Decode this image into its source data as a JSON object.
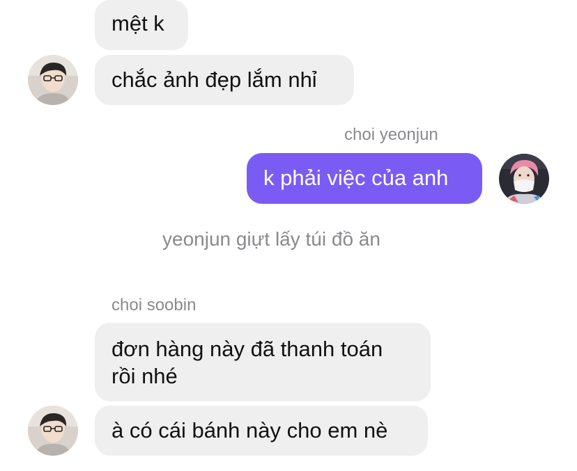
{
  "messages": {
    "m1": "mệt k",
    "m2": "chắc ảnh đẹp lắm nhỉ",
    "sender_out": "choi yeonjun",
    "m3": "k phải việc của anh",
    "system_note": "yeonjun giựt lấy túi đồ ăn",
    "sender_in": "choi soobin",
    "m4_line1": "đơn hàng này đã thanh toán",
    "m4_line2": "rồi nhé",
    "m5": "à có cái bánh này cho em nè"
  },
  "colors": {
    "incoming_bubble": "#efefef",
    "outgoing_bubble": "#7a5cf5",
    "meta_text": "#8a8a8e"
  },
  "avatars": {
    "incoming": "user-avatar-icon",
    "outgoing": "user-avatar-icon"
  }
}
